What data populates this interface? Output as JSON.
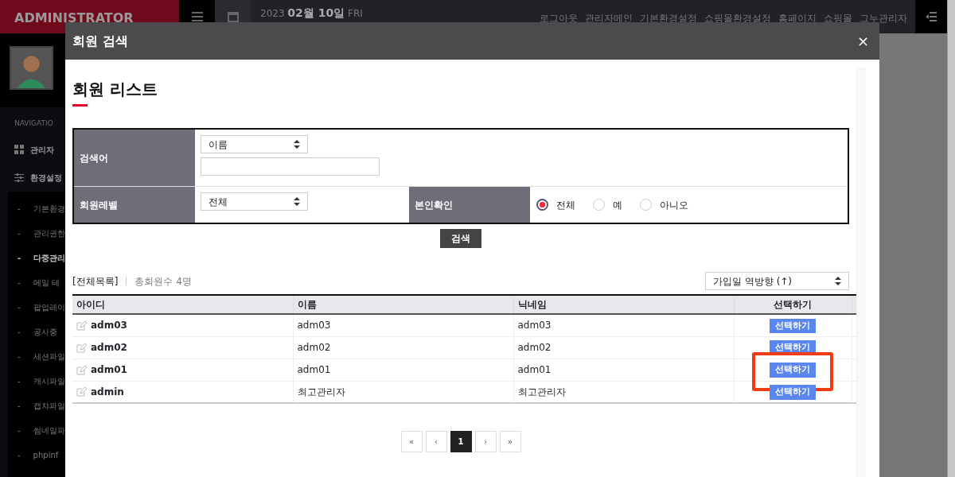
{
  "sidebar": {
    "brand": "ADMINISTRATOR",
    "section_label": "NAVIGATIO",
    "menu": [
      {
        "kind": "grid",
        "label": "관리자"
      },
      {
        "kind": "sliders",
        "label": "환경설정"
      }
    ],
    "submenu": [
      {
        "marker": "-",
        "label": "기본환경",
        "selected": false
      },
      {
        "marker": "-",
        "label": "관리권한",
        "selected": false
      },
      {
        "marker": "-",
        "label": "다중관리",
        "selected": true
      },
      {
        "marker": "-",
        "label": "메일 테",
        "selected": false
      },
      {
        "marker": "-",
        "label": "팝업레이",
        "selected": false
      },
      {
        "marker": "-",
        "label": "공사중",
        "selected": false
      },
      {
        "marker": "-",
        "label": "세션파일",
        "selected": false
      },
      {
        "marker": "-",
        "label": "캐시파일",
        "selected": false
      },
      {
        "marker": "-",
        "label": "캡챠파일",
        "selected": false
      },
      {
        "marker": "-",
        "label": "썸네일파",
        "selected": false
      },
      {
        "marker": "-",
        "label": "phpinf",
        "selected": false
      }
    ]
  },
  "topbar": {
    "year": "2023",
    "date": "02월 10일",
    "weekday": "FRI",
    "links": [
      "로그아웃",
      "관리자메인",
      "기본환경설정",
      "쇼핑몰환경설정",
      "홈페이지",
      "쇼핑몰",
      "그누관리자"
    ]
  },
  "modal": {
    "title": "회원 검색",
    "close": "×",
    "heading": "회원 리스트",
    "search_form": {
      "keyword_label": "검색어",
      "keyword_field": "이름",
      "level_label": "회원레벨",
      "level_field": "전체",
      "verify_label": "본인확인",
      "verify_options": [
        {
          "label": "전체",
          "selected": true
        },
        {
          "label": "예",
          "selected": false
        },
        {
          "label": "아니오",
          "selected": false
        }
      ]
    },
    "search_button": "검색",
    "list_label": "[전체목록]",
    "total": "총회원수 4명",
    "sort": "가입일 역방향 (↑)",
    "table": {
      "columns": [
        "아이디",
        "이름",
        "닉네임",
        "선택하기"
      ],
      "rows": [
        {
          "id": "adm03",
          "name": "adm03",
          "nickname": "adm03",
          "action": "선택하기",
          "highlighted": false
        },
        {
          "id": "adm02",
          "name": "adm02",
          "nickname": "adm02",
          "action": "선택하기",
          "highlighted": false
        },
        {
          "id": "adm01",
          "name": "adm01",
          "nickname": "adm01",
          "action": "선택하기",
          "highlighted": true
        },
        {
          "id": "admin",
          "name": "최고관리자",
          "nickname": "최고관리자",
          "action": "선택하기",
          "highlighted": false
        }
      ]
    },
    "pagination": [
      {
        "label": "«",
        "selected": false
      },
      {
        "label": "‹",
        "selected": false
      },
      {
        "label": "1",
        "selected": true
      },
      {
        "label": "›",
        "selected": false
      },
      {
        "label": "»",
        "selected": false
      }
    ]
  }
}
